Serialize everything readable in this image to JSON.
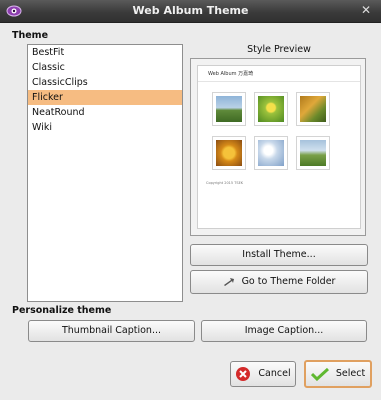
{
  "window": {
    "title": "Web Album Theme"
  },
  "theme_section": {
    "label": "Theme"
  },
  "themes": [
    "BestFit",
    "Classic",
    "ClassicClips",
    "Flicker",
    "NeatRound",
    "Wiki"
  ],
  "selected_theme": "Flicker",
  "preview": {
    "label": "Style Preview",
    "page_title": "Web Album 万嘉琦",
    "copyright": "Copyright 2015 TSEK"
  },
  "buttons": {
    "install_theme": "Install Theme...",
    "go_to_folder": "Go to Theme Folder",
    "thumbnail_caption": "Thumbnail Caption...",
    "image_caption": "Image Caption...",
    "cancel": "Cancel",
    "select": "Select"
  },
  "personalize": {
    "label": "Personalize theme"
  },
  "colors": {
    "selected_row": "#f6bc82",
    "titlebar": "#3b3b3b",
    "select_border": "#e0a060"
  },
  "icons": [
    "app-eye-icon",
    "close-icon",
    "folder-arrow-icon",
    "cancel-icon",
    "check-icon"
  ]
}
